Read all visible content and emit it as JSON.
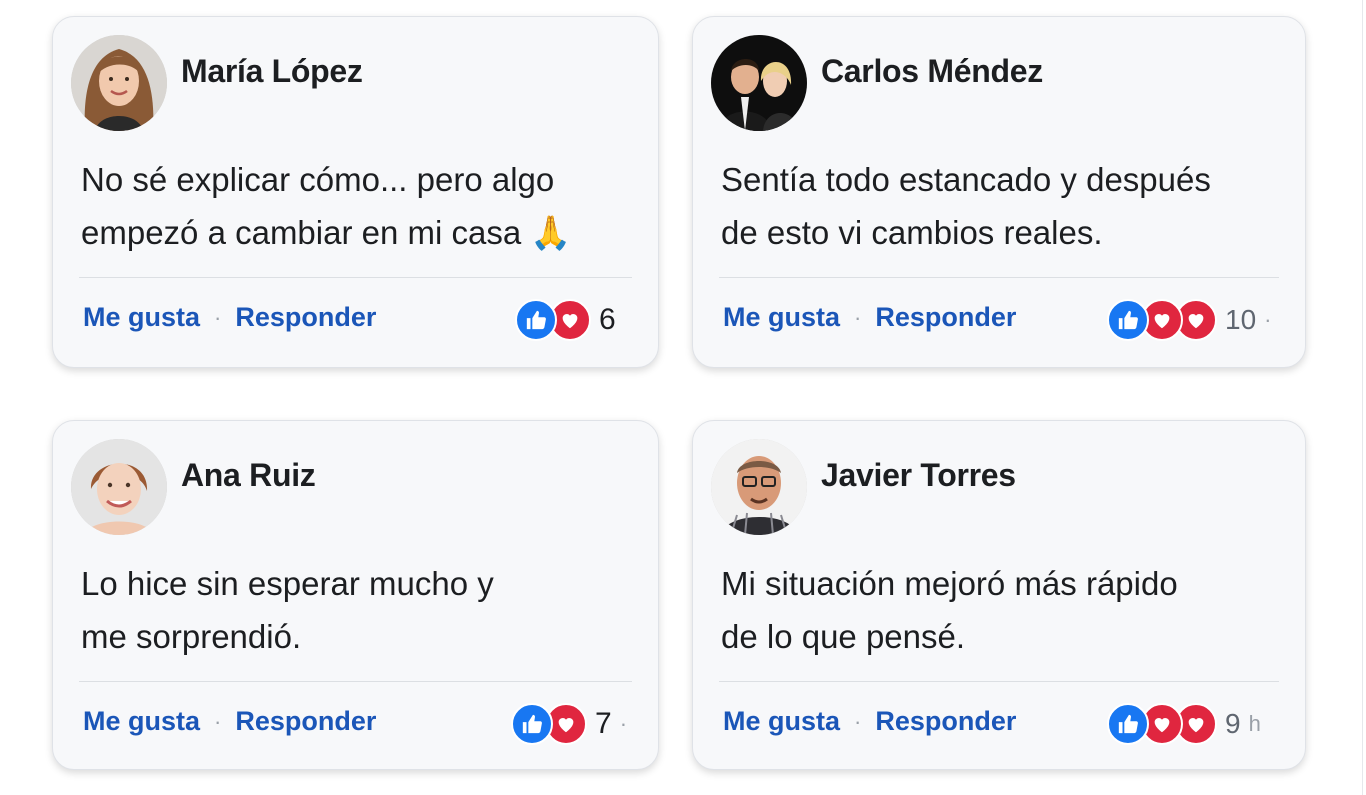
{
  "comments": [
    {
      "author": "María López",
      "text_line1": "No sé explicar cómo... pero algo",
      "text_line2": "empezó a cambiar en mi casa 🙏",
      "like_label": "Me gusta",
      "reply_label": "Responder",
      "reaction_icons": [
        "like-icon",
        "love-icon"
      ],
      "reaction_count": "6",
      "trail": ""
    },
    {
      "author": "Carlos Méndez",
      "text_line1": "Sentía todo estancado y después",
      "text_line2": "de esto vi cambios reales.",
      "like_label": "Me gusta",
      "reply_label": "Responder",
      "reaction_icons": [
        "like-icon",
        "love-icon",
        "love-icon"
      ],
      "reaction_count": "10",
      "trail": "·"
    },
    {
      "author": "Ana Ruiz",
      "text_line1": "Lo hice sin esperar mucho y",
      "text_line2": "me sorprendió.",
      "like_label": "Me gusta",
      "reply_label": "Responder",
      "reaction_icons": [
        "like-icon",
        "love-icon"
      ],
      "reaction_count": "7",
      "trail": "·"
    },
    {
      "author": "Javier Torres",
      "text_line1": "Mi situación mejoró más rápido",
      "text_line2": "de lo que pensé.",
      "like_label": "Me gusta",
      "reply_label": "Responder",
      "reaction_icons": [
        "like-icon",
        "love-icon",
        "love-icon"
      ],
      "reaction_count": "9",
      "trail": "h"
    }
  ],
  "colors": {
    "link": "#1b56b8",
    "like": "#1877f2",
    "love": "#e0263f",
    "card_bg": "#f7f8fa"
  }
}
